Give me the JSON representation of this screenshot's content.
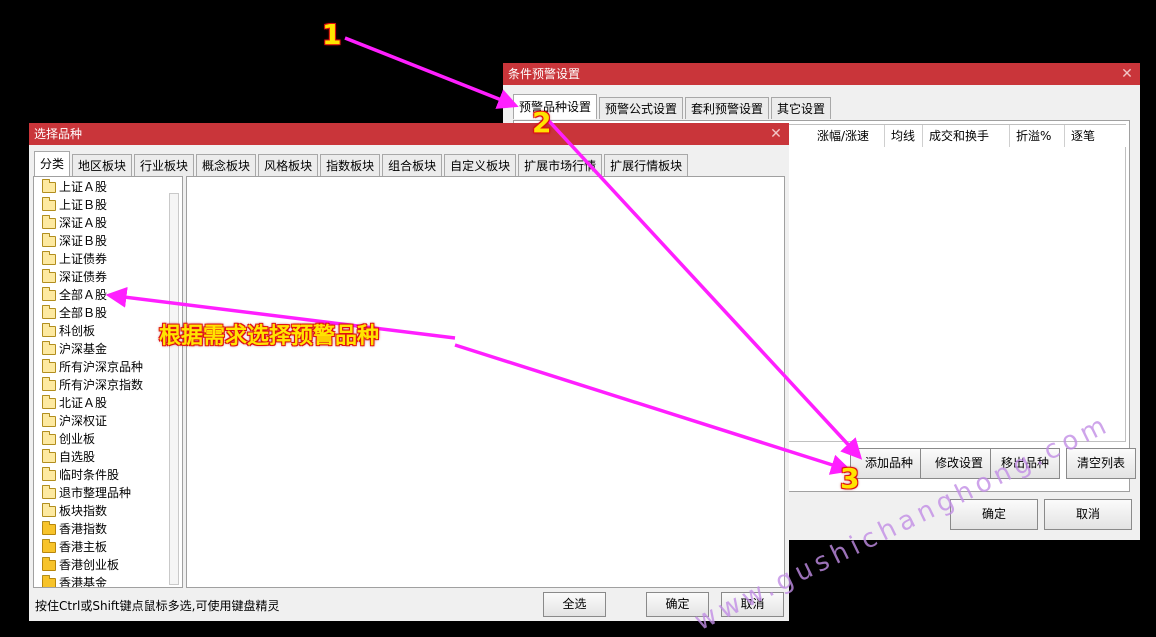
{
  "alert_window": {
    "title": "条件预警设置",
    "close": "✕",
    "tabs": [
      "预警品种设置",
      "预警公式设置",
      "套利预警设置",
      "其它设置"
    ],
    "columns": [
      "涨幅/涨速",
      "均线",
      "成交和换手",
      "折溢%",
      "逐笔"
    ],
    "buttons": {
      "add": "添加品种",
      "modify": "修改设置",
      "remove": "移出品种",
      "clear": "清空列表"
    },
    "ok": "确定",
    "cancel": "取消"
  },
  "select_window": {
    "title": "选择品种",
    "close": "✕",
    "tabs": [
      "分类",
      "地区板块",
      "行业板块",
      "概念板块",
      "风格板块",
      "指数板块",
      "组合板块",
      "自定义板块",
      "扩展市场行情",
      "扩展行情板块"
    ],
    "categories": [
      {
        "label": "上证Ａ股",
        "solid": false
      },
      {
        "label": "上证Ｂ股",
        "solid": false
      },
      {
        "label": "深证Ａ股",
        "solid": false
      },
      {
        "label": "深证Ｂ股",
        "solid": false
      },
      {
        "label": "上证债券",
        "solid": false
      },
      {
        "label": "深证债券",
        "solid": false
      },
      {
        "label": "全部Ａ股",
        "solid": false
      },
      {
        "label": "全部Ｂ股",
        "solid": false
      },
      {
        "label": "科创板",
        "solid": false
      },
      {
        "label": "沪深基金",
        "solid": false
      },
      {
        "label": "所有沪深京品种",
        "solid": false
      },
      {
        "label": "所有沪深京指数",
        "solid": false
      },
      {
        "label": "北证Ａ股",
        "solid": false
      },
      {
        "label": "沪深权证",
        "solid": false
      },
      {
        "label": "创业板",
        "solid": false
      },
      {
        "label": "自选股",
        "solid": false
      },
      {
        "label": "临时条件股",
        "solid": false
      },
      {
        "label": "退市整理品种",
        "solid": false
      },
      {
        "label": "板块指数",
        "solid": false
      },
      {
        "label": "香港指数",
        "solid": true
      },
      {
        "label": "香港主板",
        "solid": true
      },
      {
        "label": "香港创业板",
        "solid": true
      },
      {
        "label": "香港基金",
        "solid": true
      }
    ],
    "hint": "按住Ctrl或Shift键点鼠标多选,可使用键盘精灵",
    "select_all": "全选",
    "ok": "确定",
    "cancel": "取消"
  },
  "annotations": {
    "step1": "1",
    "step2": "2",
    "step3": "3",
    "callout": "根据需求选择预警品种",
    "arrow_color": "#ff1fff",
    "text_color": "#ffe400"
  },
  "watermark": "www.gushichanghong.com"
}
